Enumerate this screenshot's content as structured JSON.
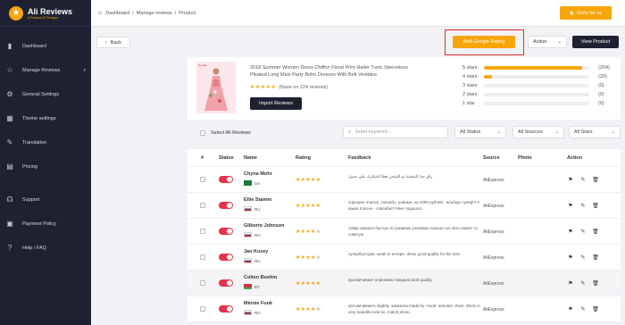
{
  "brand": {
    "name": "Ali Reviews",
    "tagline": "A Product of FireApps"
  },
  "sidebar": {
    "items": [
      {
        "label": "Dashboard",
        "icon": "chart-icon"
      },
      {
        "label": "Manage Reviews",
        "icon": "star-icon"
      },
      {
        "label": "General Settings",
        "icon": "gear-icon"
      },
      {
        "label": "Theme settings",
        "icon": "theme-icon"
      },
      {
        "label": "Translation",
        "icon": "pen-icon"
      },
      {
        "label": "Pricing",
        "icon": "pricing-icon"
      },
      {
        "label": "Support",
        "icon": "headset-icon"
      },
      {
        "label": "Payment Policy",
        "icon": "lock-icon"
      },
      {
        "label": "Help / FAQ",
        "icon": "help-icon"
      }
    ]
  },
  "breadcrumb": {
    "home": "Dashboard",
    "middle": "Manage reviews",
    "current": "Product"
  },
  "visit_label": "Visits for us",
  "toolbar": {
    "back": "Back",
    "add_google": "Add Google Rating",
    "action": "Action",
    "view_product": "View Product"
  },
  "product": {
    "shop_tag": "Google",
    "title": "2018 Summer Women Dress Chiffon Floral Print Halter Tunic Sleeveless Pleated Long Maxi Party Boho Dresses With Belt Vestidos",
    "rating_text": "(Base on 224 reviews)",
    "import_label": "Import Reviews",
    "stats": [
      {
        "label": "5 stars",
        "pct": 0.93,
        "count": "(204)"
      },
      {
        "label": "4 stars",
        "pct": 0.08,
        "count": "(20)"
      },
      {
        "label": "3 stars",
        "pct": 0,
        "count": "(0)"
      },
      {
        "label": "2 stars",
        "pct": 0,
        "count": "(0)"
      },
      {
        "label": "1 star",
        "pct": 0,
        "count": "(0)"
      }
    ]
  },
  "filters": {
    "select_all": "Select All Reviews",
    "search_placeholder": "Enter keyword...",
    "status": "All Status",
    "sources": "All Sources",
    "stars": "All Stars"
  },
  "table": {
    "headers": {
      "num": "#",
      "status": "Status",
      "name": "Name",
      "rating": "Rating",
      "feedback": "Feedback",
      "source": "Source",
      "photo": "Photo",
      "action": "Action"
    },
    "rows": [
      {
        "name": "Chyna Mohr",
        "country": "SA",
        "stars": 5,
        "feedback": "راق جدا الشحنة تم الشحن فعلا الشكرك علي جميل",
        "source": "AliExpress"
      },
      {
        "name": "Ellie Stamm",
        "country": "RU",
        "stars": 5,
        "feedback": "хорошее платье, спасибо, ровные, за 1000 рублей - вообще супер!!! А какое платье - спасибо!!! Мне подошло...",
        "source": "AliExpress"
      },
      {
        "name": "Gilberto Johnson",
        "country": "RU",
        "stars": 4,
        "feedback": "товар пришел быстро по размеру упакован хорошо на лето самое то, советую",
        "source": "AliExpress"
      },
      {
        "name": "Jan Kozey",
        "country": "RU",
        "stars": 4,
        "feedback": "супербыстрая. weak to europe. dress good quality for the size.",
        "source": "AliExpress"
      },
      {
        "name": "Colten Boehm",
        "country": "BY",
        "stars": 5,
        "feedback": "просвечивает underwear сведала best quality.",
        "source": "AliExpress"
      },
      {
        "name": "Minnie Funk",
        "country": "RU",
        "stars": 4,
        "feedback": "просвечиваеть slightly. заказала made by. Hood. наповат chest. dress is very beautiful and so, match photo.",
        "source": "AliExpress"
      }
    ]
  }
}
